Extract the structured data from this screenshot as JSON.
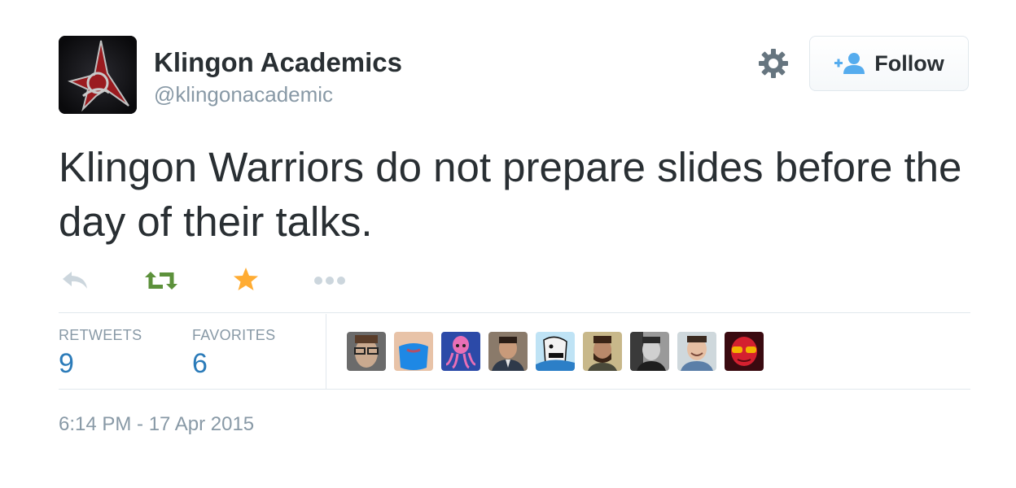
{
  "author": {
    "name": "Klingon Academics",
    "handle": "@klingonacademic",
    "avatar_icon": "klingon-trefoil-emblem"
  },
  "follow_button": {
    "label": "Follow",
    "icon": "add-user-icon"
  },
  "settings_icon": "gear-icon",
  "tweet": {
    "text": "Klingon Warriors do not prepare slides before the day of their talks."
  },
  "actions": [
    {
      "name": "reply",
      "icon": "reply-icon",
      "color": "#ccd6dd"
    },
    {
      "name": "retweet",
      "icon": "retweet-icon",
      "color": "#5c913b"
    },
    {
      "name": "favorite",
      "icon": "star-icon",
      "color": "#ffac33"
    },
    {
      "name": "more",
      "icon": "more-dots-icon",
      "color": "#ccd6dd"
    }
  ],
  "stats": {
    "retweets_label": "RETWEETS",
    "retweets_count": "9",
    "favorites_label": "FAVORITES",
    "favorites_count": "6"
  },
  "favorited_by_avatars": [
    "user-avatar-glasses-man",
    "user-avatar-blue-beard",
    "user-avatar-pink-squid",
    "user-avatar-suit-man",
    "user-avatar-cartoon-face",
    "user-avatar-bearded-man",
    "user-avatar-bw-man",
    "user-avatar-smiling-man",
    "user-avatar-red-face-goggles"
  ],
  "timestamp": "6:14 PM - 17 Apr 2015",
  "colors": {
    "text": "#292f33",
    "muted": "#8899a6",
    "link_blue": "#2b7bb9",
    "border": "#e1e8ed"
  }
}
